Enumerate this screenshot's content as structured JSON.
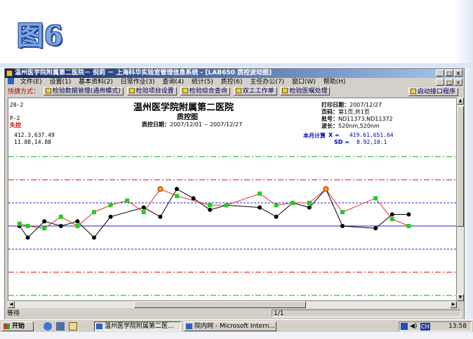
{
  "slide": {
    "title": "图6"
  },
  "window": {
    "title": "温州医学院附属第二医院－ 倪莉 － 上海科华实验室管理信息系统 - [LAB650 质控波动图]",
    "caption_buttons": [
      "_",
      "□",
      "×"
    ],
    "menu": [
      "文件(E)",
      "设置(1)",
      "基本资料(2)",
      "日常作业(3)",
      "查询(4)",
      "统计(5)",
      "质控(6)",
      "主任办公(7)",
      "窗口(W)",
      "帮助(H)"
    ],
    "quickbar": {
      "label": "快捷方式：",
      "buttons": [
        "检验数据管理(通用模式)",
        "检验项目设置",
        "检验综合查询",
        "双工工作单",
        "检验医嘱处理"
      ],
      "right_button": "启动接口程序"
    },
    "status": {
      "left": "等待",
      "page": "1/1"
    }
  },
  "report": {
    "hospital": "温州医学院附属第二医院",
    "chart_name": "质控图",
    "date_range_label": "质控日期：",
    "date_range": "2007/12/01 -- 2007/12/27",
    "left_lines": [
      "20-2",
      "P-2",
      "失控"
    ],
    "right_info": {
      "print_date_label": "打印日期：",
      "print_date": "2007/12/27",
      "page_label": "页码：",
      "page": "第1页,共1页",
      "lot_label": "批号：",
      "lot": "ND11373,ND11372",
      "wavelength_label": "波长：",
      "wavelength": "520nm,520nm"
    },
    "stats_left": [
      "412.3,637.49",
      "11.88,14.88"
    ],
    "stats_right": {
      "month_label": "本月计算",
      "mean_label": "X =",
      "mean": "419.61,651.64",
      "sd_label": "SD =",
      "sd": "8.92,10.1"
    }
  },
  "chart_data": {
    "type": "line",
    "y_range": [
      -3.4,
      3.4
    ],
    "reference_lines": [
      {
        "value": 3,
        "style": "dash-dot",
        "color": "#00b000"
      },
      {
        "value": 2,
        "style": "dash-dot",
        "color": "#e00000"
      },
      {
        "value": 1,
        "style": "dashed",
        "color": "#2020c0"
      },
      {
        "value": 0,
        "style": "solid",
        "color": "#2020c0"
      },
      {
        "value": -1,
        "style": "dashed",
        "color": "#2020c0"
      },
      {
        "value": -2,
        "style": "dash-dot",
        "color": "#e00000"
      },
      {
        "value": -3,
        "style": "dash-dot",
        "color": "#00b000"
      }
    ],
    "series": [
      {
        "marker": "circle",
        "line_color": "#000000",
        "marker_color": "#000000",
        "x": [
          0.5,
          1,
          2,
          3,
          4,
          5,
          6,
          8,
          9,
          10,
          11,
          12,
          13,
          15,
          16,
          17,
          18,
          19,
          20,
          22,
          23,
          24
        ],
        "y": [
          0,
          -0.5,
          0.2,
          0,
          0.2,
          -0.5,
          0.4,
          0.8,
          0.4,
          1.6,
          1.2,
          0.7,
          0.9,
          0.8,
          0.4,
          1.0,
          0.8,
          1.6,
          0,
          -0.1,
          0.5,
          0.5
        ]
      },
      {
        "marker": "square",
        "line_color": "#e03020",
        "marker_color": "#20d020",
        "x": [
          0.5,
          1,
          2,
          3,
          4,
          5,
          6,
          7,
          8,
          9,
          10,
          12,
          13,
          15,
          16,
          17,
          18,
          19,
          20,
          22,
          23,
          24
        ],
        "y": [
          0.1,
          0,
          -0.1,
          0.4,
          0,
          0.6,
          0.9,
          1.1,
          0.6,
          1.6,
          1.3,
          0.9,
          0.9,
          1.4,
          0.9,
          1.0,
          1.0,
          1.6,
          0.6,
          1.2,
          0.3,
          0
        ]
      }
    ],
    "flagged_points": [
      {
        "x": 9,
        "y": 1.6
      },
      {
        "x": 19,
        "y": 1.6
      }
    ]
  },
  "taskbar": {
    "start": "开始",
    "tasks": [
      "温州医学院附属第二医...",
      "院内网 - Microsoft Intern..."
    ],
    "tray_lang": "CH",
    "clock": "13:58"
  }
}
